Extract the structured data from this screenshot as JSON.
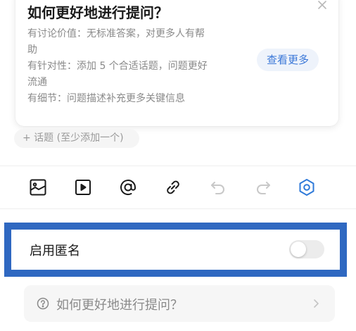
{
  "tip": {
    "title": "如何更好地进行提问？",
    "lines": [
      "有讨论价值：无标准答案，对更多人有帮",
      "助",
      " 有针对性：添加 5 个合适话题，问题更好",
      "流通",
      " 有细节：问题描述补充更多关键信息"
    ],
    "more_label": "查看更多"
  },
  "topic": {
    "chip_label": "+ 话题 (至少添加一个)"
  },
  "toolbar": {
    "icons": [
      "image-icon",
      "video-icon",
      "mention-icon",
      "link-icon",
      "undo-icon",
      "redo-icon",
      "settings-icon"
    ],
    "active_color": "#2f7ad9",
    "disabled_color": "#c8c8c8"
  },
  "anonymous": {
    "label": "启用匿名",
    "enabled": false
  },
  "help": {
    "label": "如何更好地进行提问？"
  },
  "colors": {
    "accent": "#3b78d8",
    "highlight_border": "#2f68c1"
  }
}
